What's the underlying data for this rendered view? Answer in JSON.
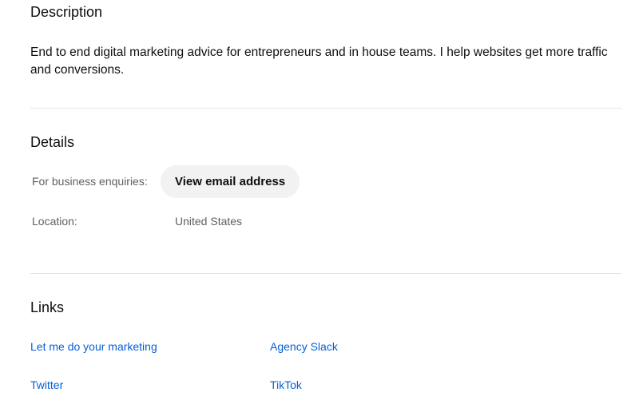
{
  "description": {
    "title": "Description",
    "text": "End to end digital marketing advice for entrepreneurs and in house teams. I help websites get more traffic and conversions."
  },
  "details": {
    "title": "Details",
    "business_label": "For business enquiries:",
    "email_button_label": "View email address",
    "location_label": "Location:",
    "location_value": "United States"
  },
  "links": {
    "title": "Links",
    "items": [
      {
        "label": "Let me do your marketing"
      },
      {
        "label": "Agency Slack"
      },
      {
        "label": "Twitter"
      },
      {
        "label": "TikTok"
      }
    ]
  },
  "colors": {
    "link": "#065fd4",
    "button_bg": "#f2f2f2",
    "secondary_text": "#606060",
    "divider": "#e5e5e5"
  }
}
